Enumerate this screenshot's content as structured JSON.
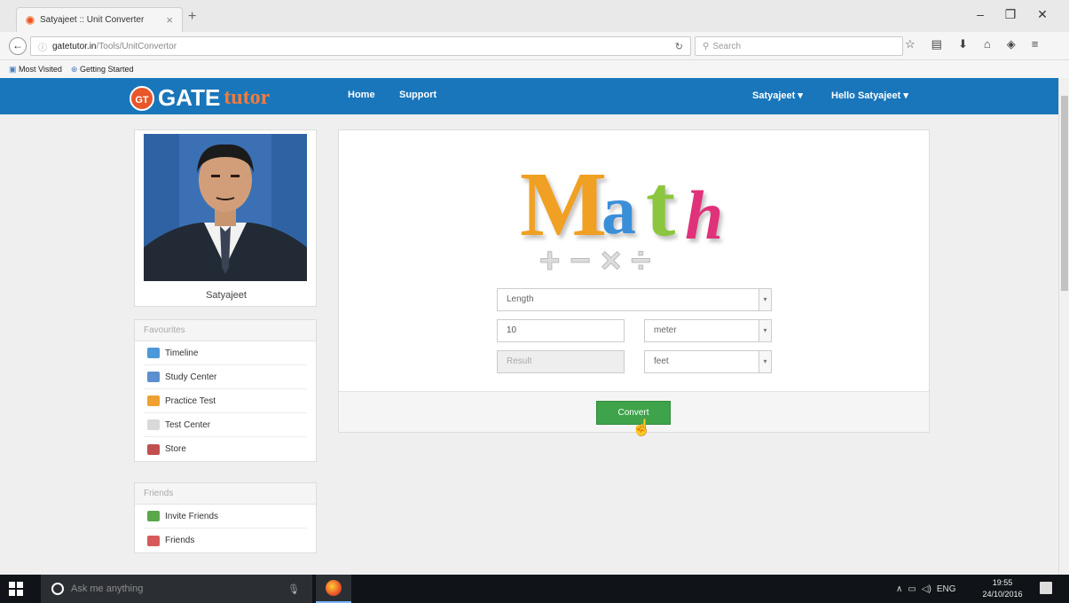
{
  "browser": {
    "tab_title": "Satyajeet :: Unit Converter",
    "tab_close": "×",
    "new_tab": "+",
    "url_domain": "gatetutor.in",
    "url_path": "/Tools/UnitConvertor",
    "search_placeholder": "Search",
    "bookmarks": [
      "Most Visited",
      "Getting Started"
    ]
  },
  "site": {
    "logo_badge": "GT",
    "logo_gate": "GATE",
    "logo_tutor": "tutor",
    "nav": [
      "Home",
      "Support"
    ],
    "user_menu": "Satyajeet",
    "hello_menu": "Hello Satyajeet"
  },
  "profile": {
    "name": "Satyajeet"
  },
  "favourites": {
    "heading": "Favourites",
    "items": [
      "Timeline",
      "Study Center",
      "Practice Test",
      "Test Center",
      "Store"
    ]
  },
  "friends": {
    "heading": "Friends",
    "items": [
      "Invite Friends",
      "Friends"
    ]
  },
  "converter": {
    "logo_word": "Math",
    "logo_ops": "+ − × ÷",
    "category": "Length",
    "input_value": "10",
    "from_unit": "meter",
    "result_placeholder": "Result",
    "to_unit": "feet",
    "convert_label": "Convert"
  },
  "taskbar": {
    "search_placeholder": "Ask me anything",
    "lang": "ENG",
    "time": "19:55",
    "date": "24/10/2016"
  },
  "colors": {
    "header_blue": "#1976ba",
    "convert_green": "#3ea34a",
    "logo_orange": "#f47b3a"
  }
}
